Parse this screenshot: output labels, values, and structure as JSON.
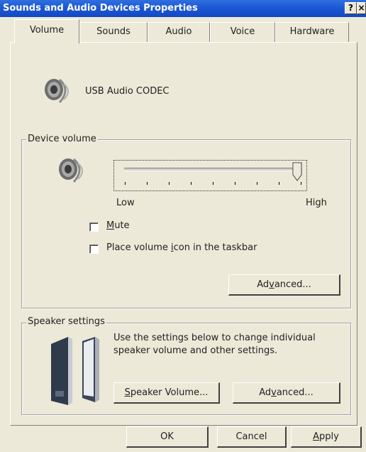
{
  "window": {
    "title": "Sounds and Audio Devices Properties"
  },
  "titlebar": {
    "help_label": "?",
    "close_label": "×"
  },
  "tabs": [
    {
      "label": "Volume",
      "active": true
    },
    {
      "label": "Sounds",
      "active": false
    },
    {
      "label": "Audio",
      "active": false
    },
    {
      "label": "Voice",
      "active": false
    },
    {
      "label": "Hardware",
      "active": false
    }
  ],
  "device": {
    "name": "USB Audio CODEC",
    "icon": "speaker-icon"
  },
  "device_volume": {
    "legend": "Device volume",
    "low_label": "Low",
    "high_label": "High",
    "level_fraction": 1.0,
    "mute": {
      "prefix": "",
      "accel": "M",
      "suffix": "ute",
      "checked": false
    },
    "taskbar_icon": {
      "prefix": "Place volume ",
      "accel": "i",
      "suffix": "con in the taskbar",
      "checked": false
    },
    "advanced_button": {
      "prefix": "Ad",
      "accel": "v",
      "suffix": "anced..."
    }
  },
  "speaker_settings": {
    "legend": "Speaker settings",
    "description_line1": "Use the settings below to change individual",
    "description_line2": "speaker volume and other settings.",
    "speaker_volume_button": {
      "prefix": "",
      "accel": "S",
      "suffix": "peaker Volume..."
    },
    "advanced_button": {
      "prefix": "Ad",
      "accel": "v",
      "suffix": "anced..."
    }
  },
  "footer": {
    "ok_label": "OK",
    "cancel_label": "Cancel",
    "apply_button": {
      "prefix": "",
      "accel": "A",
      "suffix": "pply"
    }
  },
  "colors": {
    "titlebar": "#1c58d4",
    "window_bg": "#ece9d8"
  }
}
